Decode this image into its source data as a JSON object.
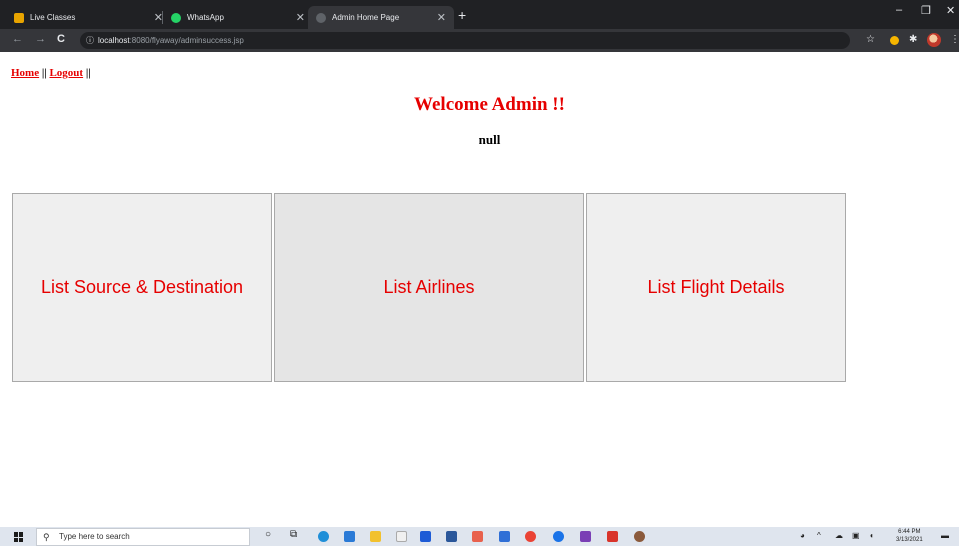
{
  "browser": {
    "tabs": [
      {
        "title": "Live Classes",
        "active": false
      },
      {
        "title": "WhatsApp",
        "active": false
      },
      {
        "title": "Admin Home Page",
        "active": true
      }
    ],
    "new_tab": "+",
    "address": {
      "host": "localhost",
      "rest": ":8080/flyaway/adminsuccess.jsp"
    }
  },
  "nav": {
    "home": "Home",
    "separator1": "||",
    "logout": "Logout",
    "separator2": "||"
  },
  "welcome": "Welcome Admin !!",
  "message": "null",
  "cards": [
    {
      "label": "List Source & Destination"
    },
    {
      "label": "List Airlines"
    },
    {
      "label": "List Flight Details"
    }
  ],
  "taskbar": {
    "search_placeholder": "Type here to search",
    "time": "6:44 PM",
    "date": "3/13/2021"
  },
  "colors": {
    "accent_red": "#e60000",
    "card_bg": "#efefef",
    "card_border": "#a9a9a9"
  }
}
